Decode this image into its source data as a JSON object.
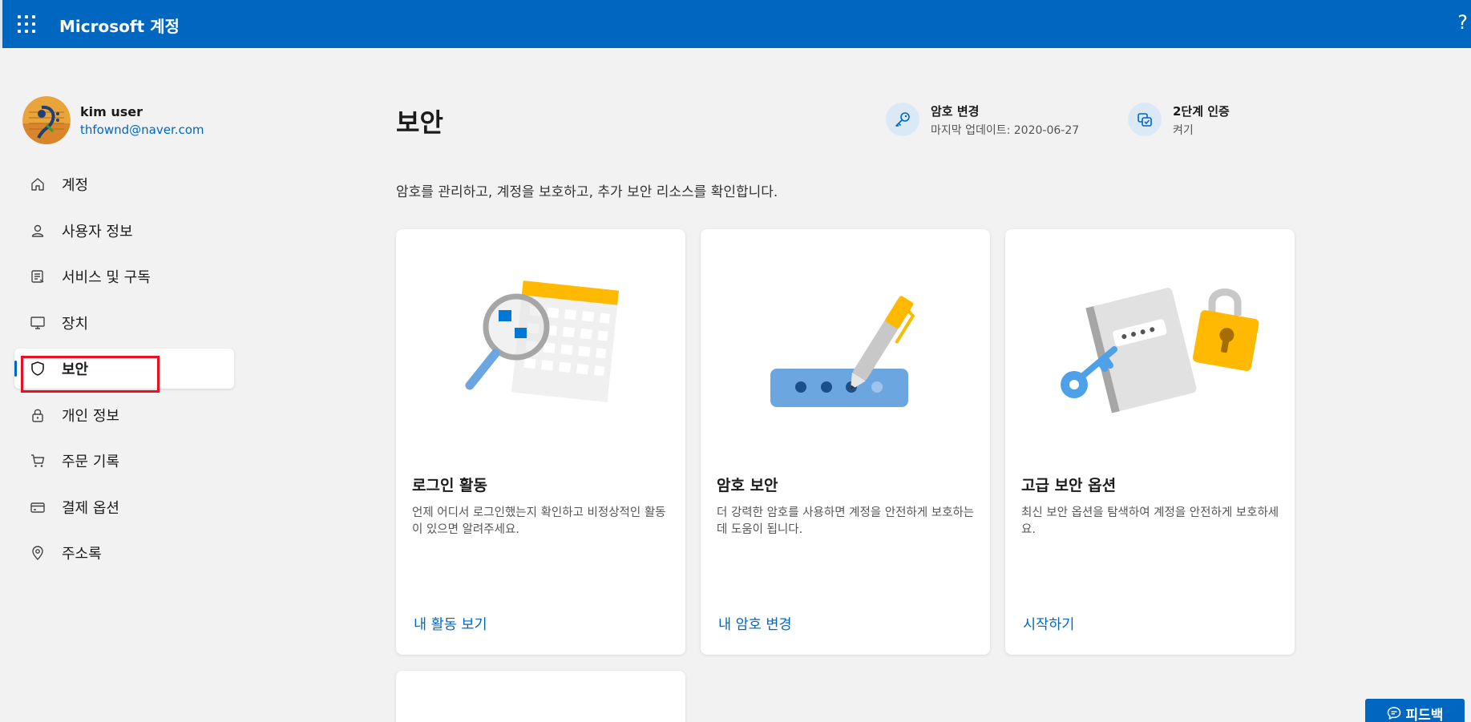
{
  "app": {
    "title": "Microsoft 계정",
    "help_glyph": "?"
  },
  "profile": {
    "name": "kim user",
    "email": "thfownd@naver.com"
  },
  "sidebar": {
    "items": [
      {
        "label": "계정",
        "icon": "home-icon"
      },
      {
        "label": "사용자 정보",
        "icon": "person-icon"
      },
      {
        "label": "서비스 및 구독",
        "icon": "subscription-icon"
      },
      {
        "label": "장치",
        "icon": "device-icon"
      },
      {
        "label": "보안",
        "icon": "shield-icon",
        "active": true
      },
      {
        "label": "개인 정보",
        "icon": "lock-icon"
      },
      {
        "label": "주문 기록",
        "icon": "cart-icon"
      },
      {
        "label": "결제 옵션",
        "icon": "card-icon"
      },
      {
        "label": "주소록",
        "icon": "location-icon"
      }
    ]
  },
  "main": {
    "title": "보안",
    "description": "암호를 관리하고, 계정을 보호하고, 추가 보안 리소스를 확인합니다.",
    "quick_actions": [
      {
        "title": "암호 변경",
        "subtitle": "마지막 업데이트: 2020-06-27",
        "icon": "key-icon"
      },
      {
        "title": "2단계 인증",
        "subtitle": "켜기",
        "icon": "two-step-icon"
      }
    ],
    "cards": [
      {
        "title": "로그인 활동",
        "description": "언제 어디서 로그인했는지 확인하고 비정상적인 활동이 있으면 알려주세요.",
        "link": "내 활동 보기"
      },
      {
        "title": "암호 보안",
        "description": "더 강력한 암호를 사용하면 계정을 안전하게 보호하는 데 도움이 됩니다.",
        "link": "내 암호 변경"
      },
      {
        "title": "고급 보안 옵션",
        "description": "최신 보안 옵션을 탐색하여 계정을 안전하게 보호하세요.",
        "link": "시작하기"
      }
    ]
  },
  "feedback": {
    "label": "피드백"
  },
  "colors": {
    "brand": "#0067c0",
    "highlight": "#e81123"
  }
}
